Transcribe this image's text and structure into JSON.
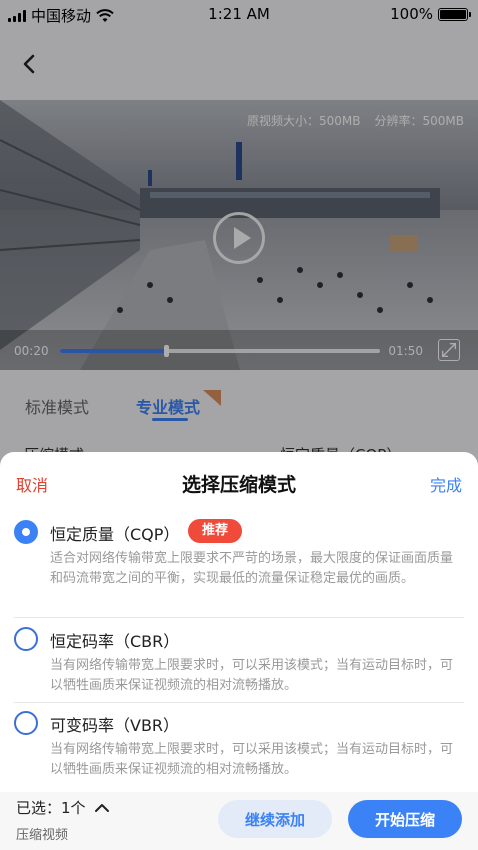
{
  "status_bar": {
    "carrier": "中国移动",
    "time": "1:21 AM",
    "battery": "100%"
  },
  "video": {
    "info_size": "原视频大小：500MB",
    "info_resolution": "分辨率：500MB",
    "current_time": "00:20",
    "total_time": "01:50",
    "progress": 0.33
  },
  "mode_tabs": {
    "standard": "标准模式",
    "pro": "专业模式"
  },
  "background_row": {
    "label": "压缩模式",
    "value": "恒定质量（CQP）"
  },
  "sheet": {
    "cancel": "取消",
    "title": "选择压缩模式",
    "done": "完成",
    "options": [
      {
        "title": "恒定质量（CQP）",
        "tag": "推荐",
        "desc": "适合对网络传输带宽上限要求不严苛的场景，最大限度的保证画面质量和码流带宽之间的平衡，实现最低的流量保证稳定最优的画质。",
        "checked": true
      },
      {
        "title": "恒定码率（CBR）",
        "desc": "当有网络传输带宽上限要求时，可以采用该模式；当有运动目标时，可以牺牲画质来保证视频流的相对流畅播放。",
        "checked": false
      },
      {
        "title": "可变码率（VBR）",
        "desc": "当有网络传输带宽上限要求时，可以采用该模式；当有运动目标时，可以牺牲画质来保证视频流的相对流畅播放。",
        "checked": false
      }
    ]
  },
  "bottom_bar": {
    "selected": "已选：1个",
    "sub_label": "压缩视频",
    "continue_label": "继续添加",
    "start_label": "开始压缩"
  },
  "colors": {
    "accent": "#3b82f6",
    "cancel": "#e0402e",
    "tag": "#ef4a3a"
  }
}
